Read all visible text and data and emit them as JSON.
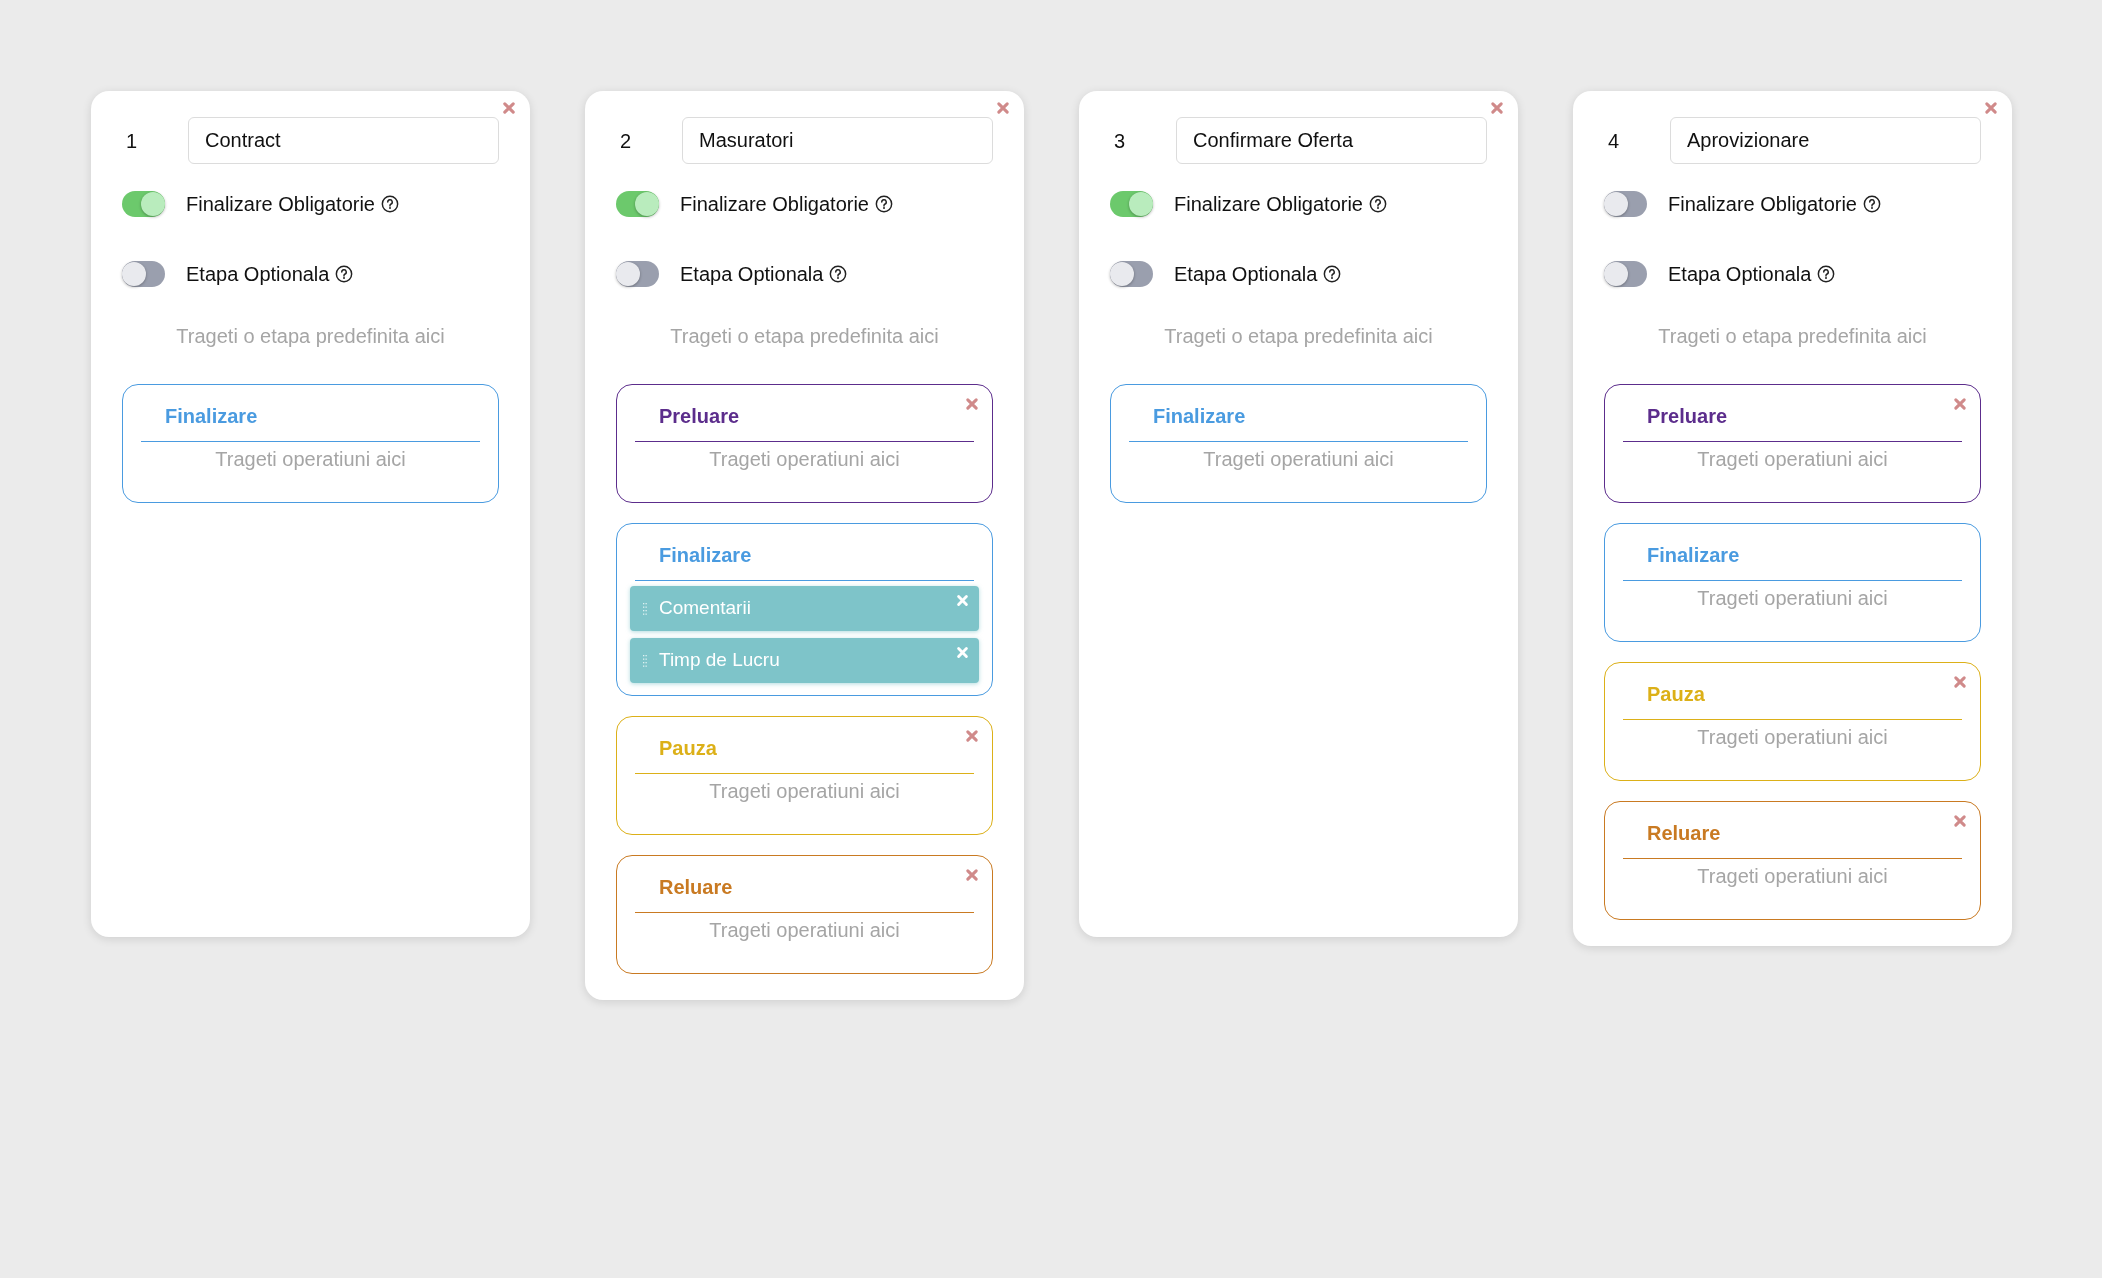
{
  "steps": [
    {
      "number": "1",
      "name": "Contract",
      "toggles": [
        {
          "label": "Finalizare Obligatorie",
          "on": true
        },
        {
          "label": "Etapa Optionala",
          "on": false
        }
      ],
      "drop_hint": "Trageti o etapa predefinita aici",
      "stages": [
        {
          "title": "Finalizare",
          "color": "#4a9be0",
          "removable": false,
          "placeholder": "Trageti operatiuni aici"
        }
      ]
    },
    {
      "number": "2",
      "name": "Masuratori",
      "toggles": [
        {
          "label": "Finalizare Obligatorie",
          "on": true
        },
        {
          "label": "Etapa Optionala",
          "on": false
        }
      ],
      "drop_hint": "Trageti o etapa predefinita aici",
      "stages": [
        {
          "title": "Preluare",
          "color": "#5c2d8c",
          "removable": true,
          "placeholder": "Trageti operatiuni aici"
        },
        {
          "title": "Finalizare",
          "color": "#4a9be0",
          "removable": false,
          "operations": [
            {
              "label": "Comentarii"
            },
            {
              "label": "Timp de Lucru"
            }
          ]
        },
        {
          "title": "Pauza",
          "color": "#dcb018",
          "removable": true,
          "placeholder": "Trageti operatiuni aici"
        },
        {
          "title": "Reluare",
          "color": "#c97a22",
          "removable": true,
          "placeholder": "Trageti operatiuni aici"
        }
      ]
    },
    {
      "number": "3",
      "name": "Confirmare Oferta",
      "toggles": [
        {
          "label": "Finalizare Obligatorie",
          "on": true
        },
        {
          "label": "Etapa Optionala",
          "on": false
        }
      ],
      "drop_hint": "Trageti o etapa predefinita aici",
      "stages": [
        {
          "title": "Finalizare",
          "color": "#4a9be0",
          "removable": false,
          "placeholder": "Trageti operatiuni aici"
        }
      ]
    },
    {
      "number": "4",
      "name": "Aprovizionare",
      "toggles": [
        {
          "label": "Finalizare Obligatorie",
          "on": false
        },
        {
          "label": "Etapa Optionala",
          "on": false
        }
      ],
      "drop_hint": "Trageti o etapa predefinita aici",
      "stages": [
        {
          "title": "Preluare",
          "color": "#5c2d8c",
          "removable": true,
          "placeholder": "Trageti operatiuni aici"
        },
        {
          "title": "Finalizare",
          "color": "#4a9be0",
          "removable": false,
          "placeholder": "Trageti operatiuni aici"
        },
        {
          "title": "Pauza",
          "color": "#dcb018",
          "removable": true,
          "placeholder": "Trageti operatiuni aici"
        },
        {
          "title": "Reluare",
          "color": "#c97a22",
          "removable": true,
          "placeholder": "Trageti operatiuni aici"
        }
      ]
    }
  ]
}
